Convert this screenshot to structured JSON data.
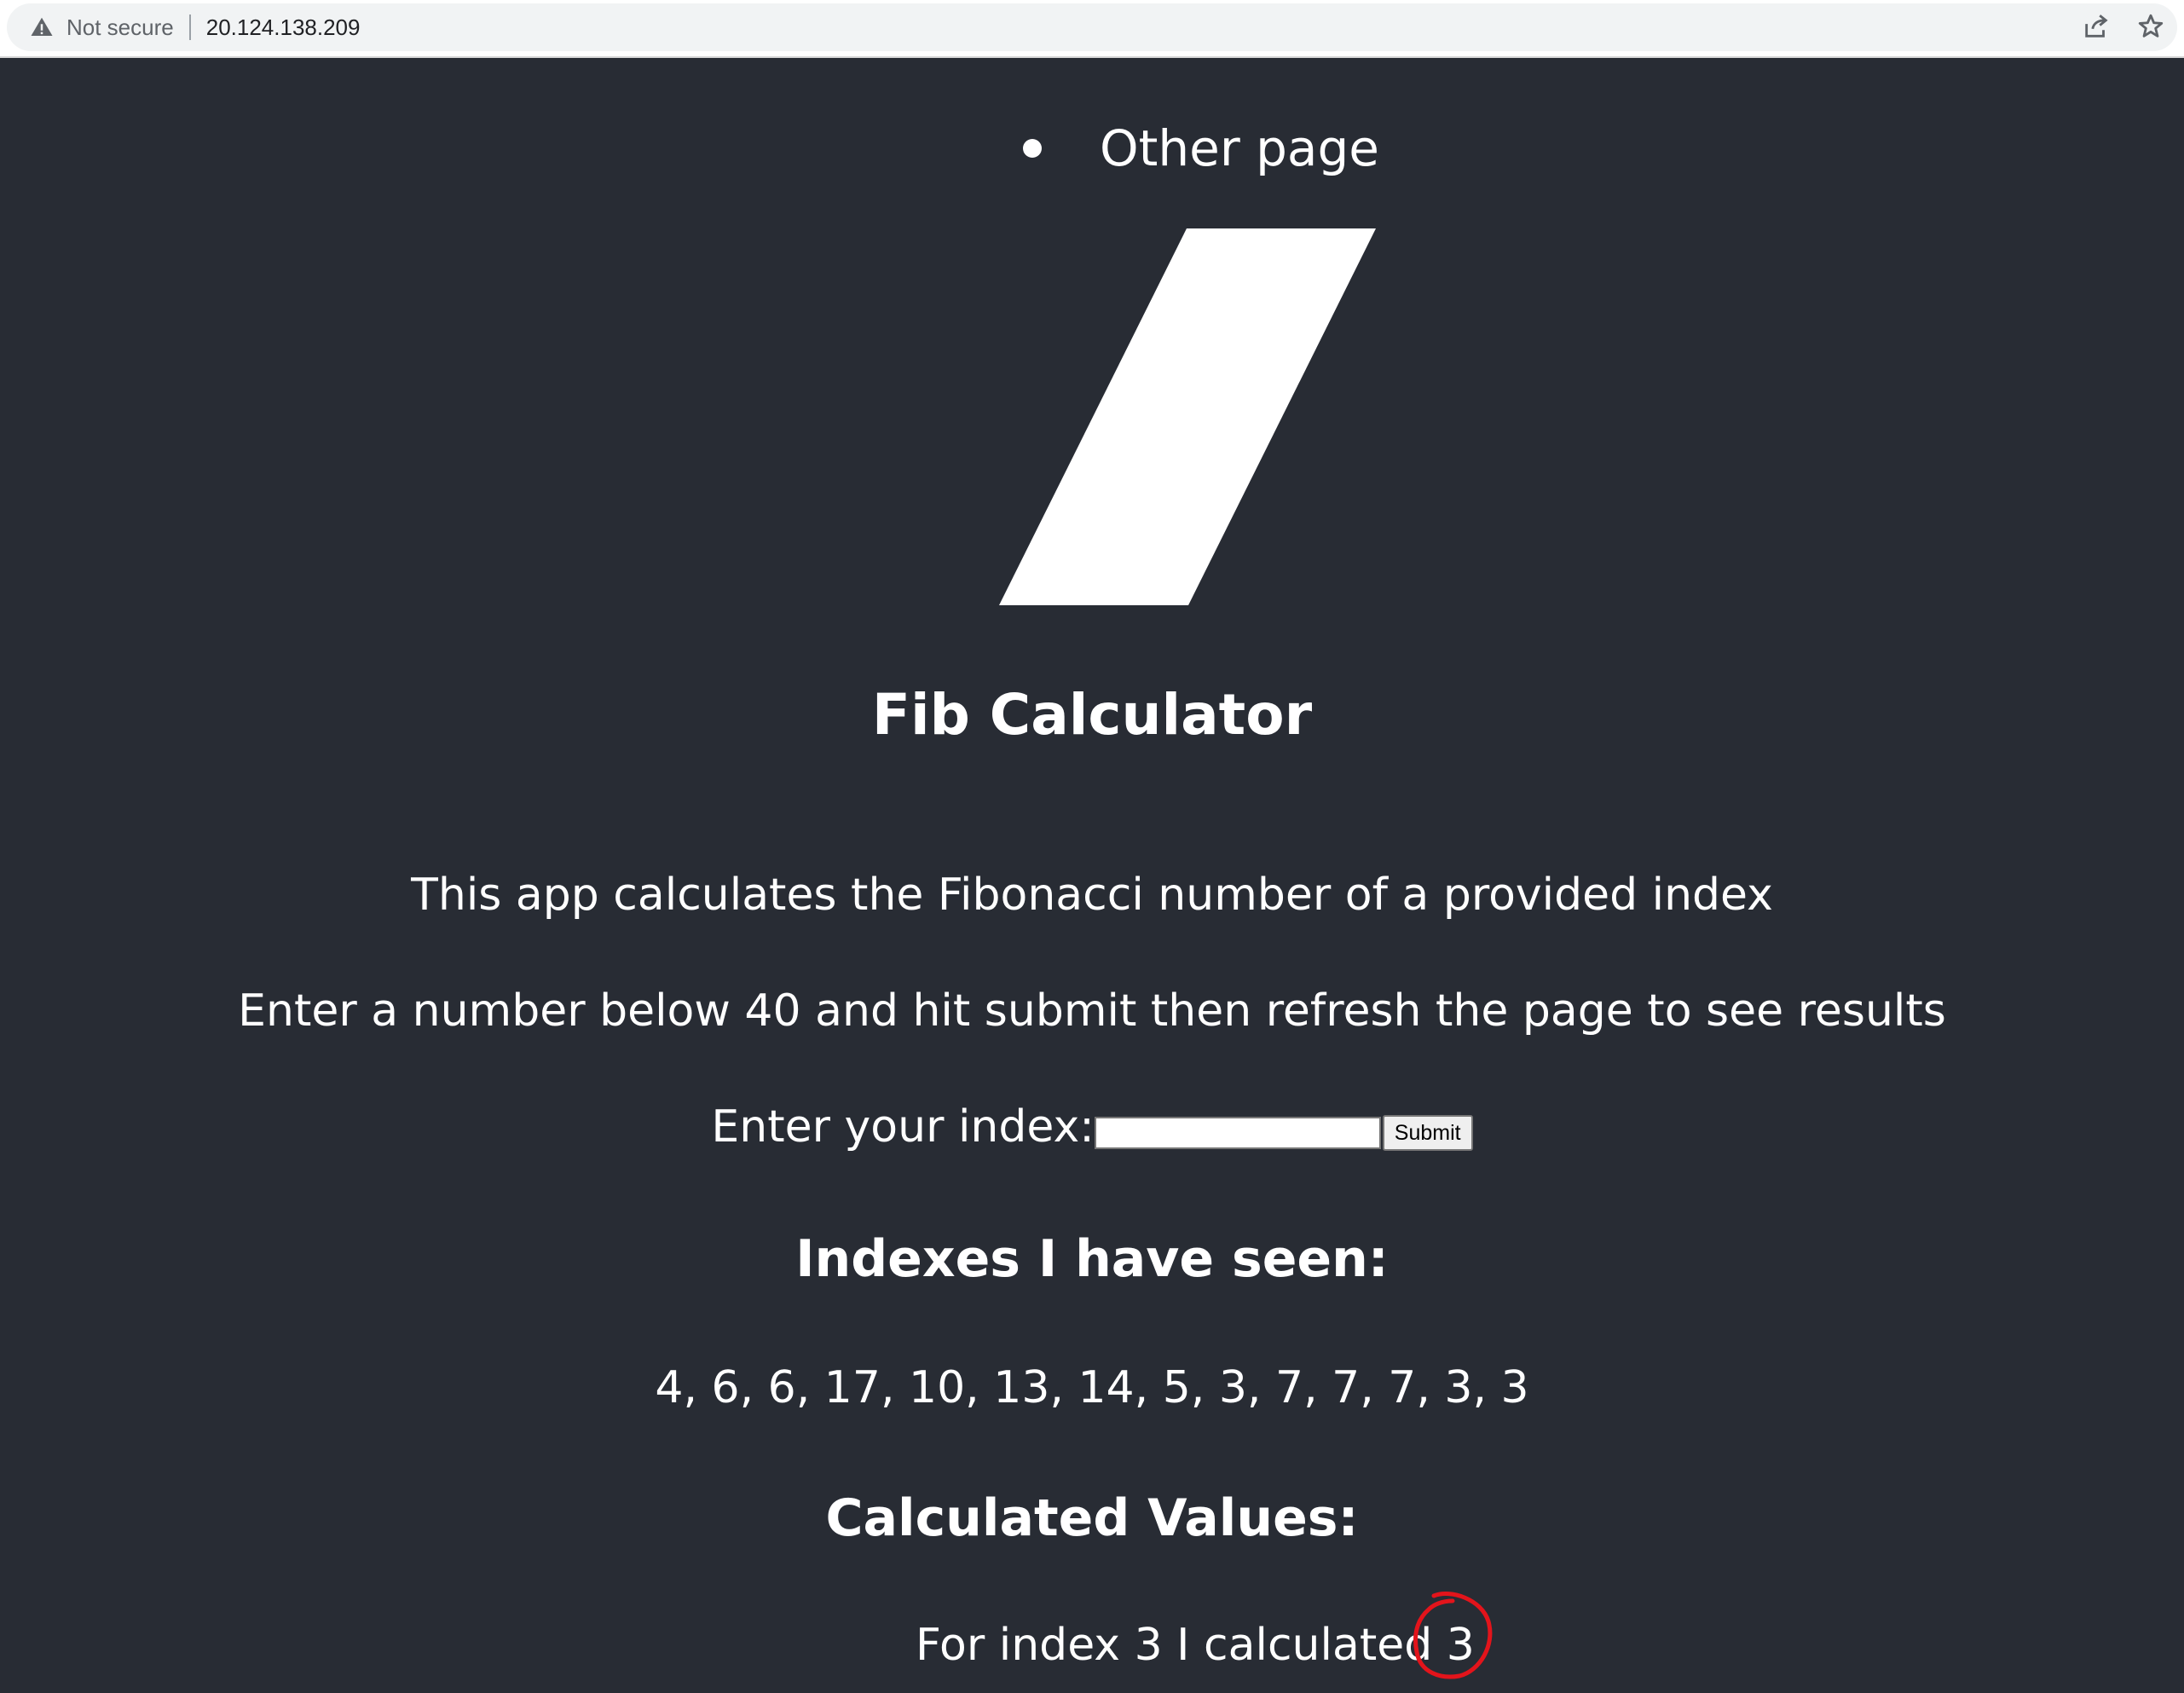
{
  "browser": {
    "security_label": "Not secure",
    "url": "20.124.138.209",
    "icons": [
      "warning-icon",
      "share-icon",
      "star-icon"
    ]
  },
  "nav": {
    "links": [
      {
        "label": "Other page"
      }
    ]
  },
  "logo": {
    "icon": "parallelogram-logo",
    "color": "#ffffff"
  },
  "header": {
    "title": "Fib Calculator"
  },
  "intro": {
    "line1": "This app calculates the Fibonacci number of a provided index",
    "line2": "Enter a number below 40 and hit submit then refresh the page to see results"
  },
  "form": {
    "label": "Enter your index:",
    "input_value": "",
    "submit_label": "Submit"
  },
  "indexes": {
    "heading": "Indexes I have seen:",
    "values_text": "4, 6, 6, 17, 10, 13, 14, 5, 3, 7, 7, 7, 3, 3"
  },
  "calculated": {
    "heading": "Calculated Values:",
    "rows": [
      {
        "prefix": "For index 3 I calculated",
        "value": "3"
      }
    ]
  },
  "colors": {
    "background": "#282c34",
    "text": "#ffffff",
    "annotation": "#e3141b"
  }
}
